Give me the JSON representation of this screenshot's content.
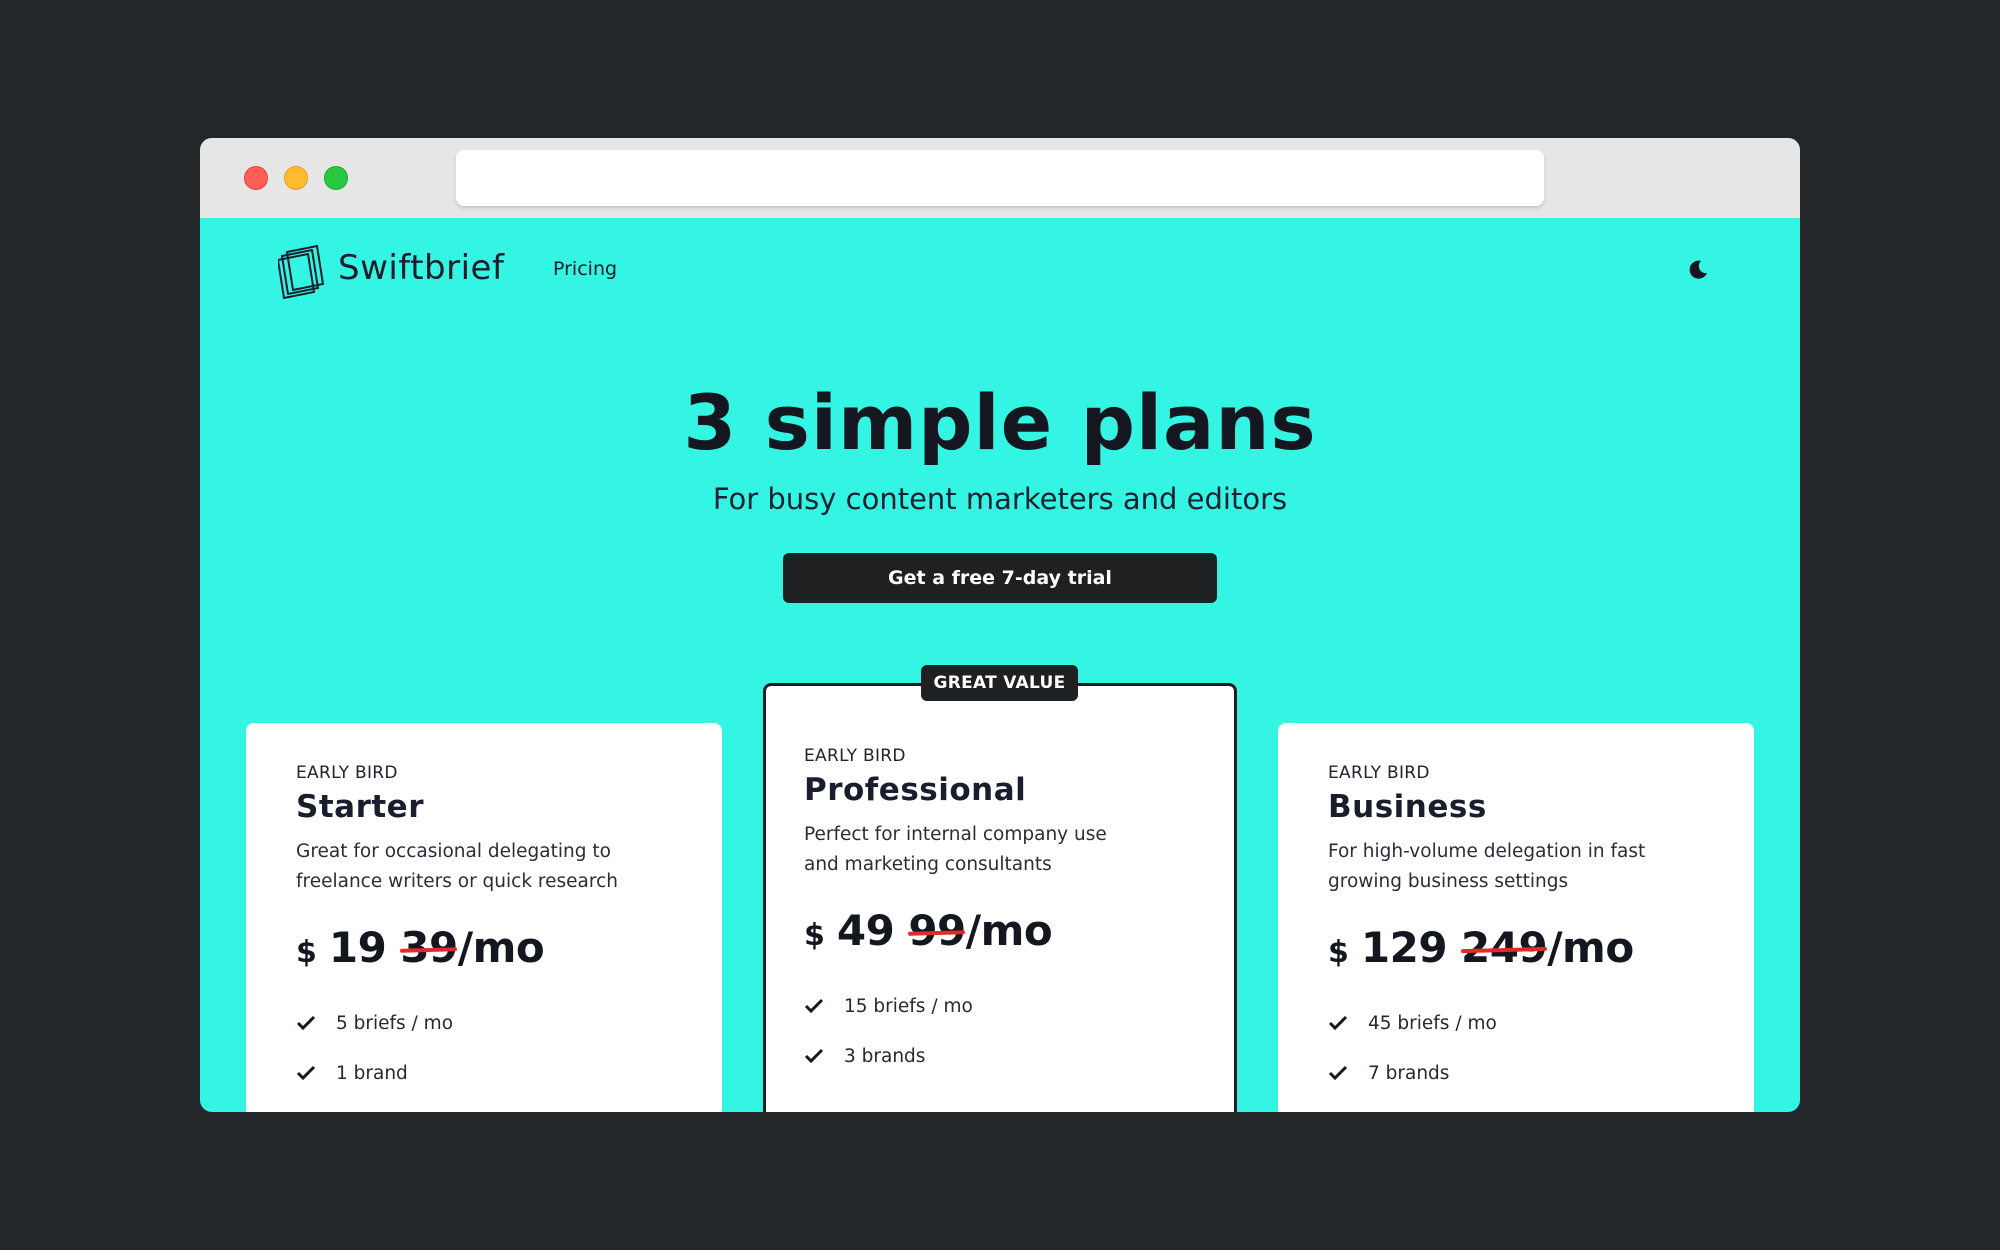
{
  "nav": {
    "brand": "Swiftbrief",
    "links": [
      {
        "label": "Pricing"
      }
    ]
  },
  "hero": {
    "title": "3 simple plans",
    "subtitle": "For busy content marketers and editors",
    "cta": "Get a free 7-day trial"
  },
  "featured_badge": "GREAT VALUE",
  "plans": [
    {
      "tier": "EARLY BIRD",
      "name": "Starter",
      "description": "Great for occasional delegating to freelance writers or quick research",
      "currency": "$",
      "price": "19",
      "old_price": "39",
      "period": "/mo",
      "features": [
        "5 briefs / mo",
        "1 brand"
      ]
    },
    {
      "tier": "EARLY BIRD",
      "name": "Professional",
      "description": "Perfect for internal company use and marketing consultants",
      "currency": "$",
      "price": "49",
      "old_price": "99",
      "period": "/mo",
      "features": [
        "15 briefs / mo",
        "3 brands"
      ]
    },
    {
      "tier": "EARLY BIRD",
      "name": "Business",
      "description": "For high-volume delegation in fast growing business settings",
      "currency": "$",
      "price": "129",
      "old_price": "249",
      "period": "/mo",
      "features": [
        "45 briefs / mo",
        "7 brands"
      ]
    }
  ],
  "colors": {
    "page_background": "#24282a",
    "accent_background": "#34f5e3",
    "dark_button": "#1f2022",
    "strike": "#e32a2a"
  },
  "icons": {
    "logo": "stacked-squares-logo-icon",
    "theme": "moon-icon",
    "feature": "checkmark-icon"
  }
}
